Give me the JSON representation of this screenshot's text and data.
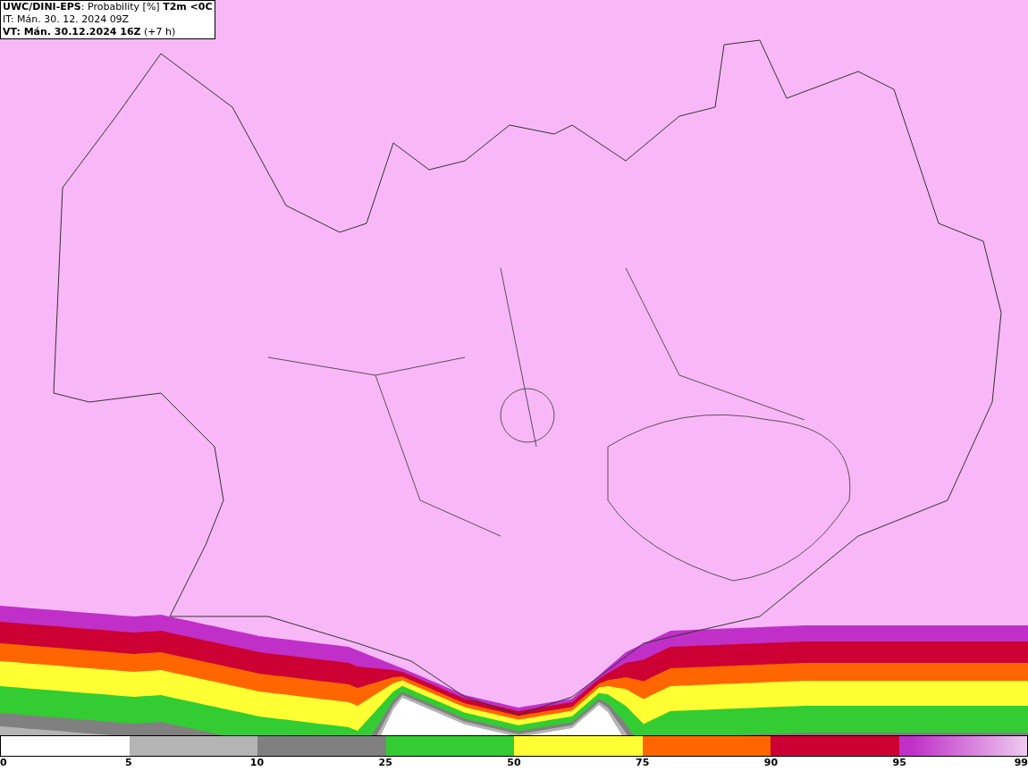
{
  "header": {
    "lines": [
      "**UWC/DINI-EPS**: Probability [%] **T2m <0C**",
      "IT: Mán. 30. 12. 2024 09Z",
      "**VT: Mán. 30.12.2024 16Z** (+7 h)"
    ]
  },
  "legend": {
    "segments": [
      {
        "color": "#ffffff"
      },
      {
        "color": "#b4b4b4"
      },
      {
        "color": "#808080"
      },
      {
        "color": "#33cc33"
      },
      {
        "color": "#ffff33"
      },
      {
        "color": "#ff6600"
      },
      {
        "color": "#cc0033"
      },
      {
        "color": "#c030c8",
        "kind": "gradient"
      }
    ],
    "labels": [
      "0",
      "5",
      "10",
      "25",
      "50",
      "75",
      "90",
      "95",
      "99"
    ]
  }
}
